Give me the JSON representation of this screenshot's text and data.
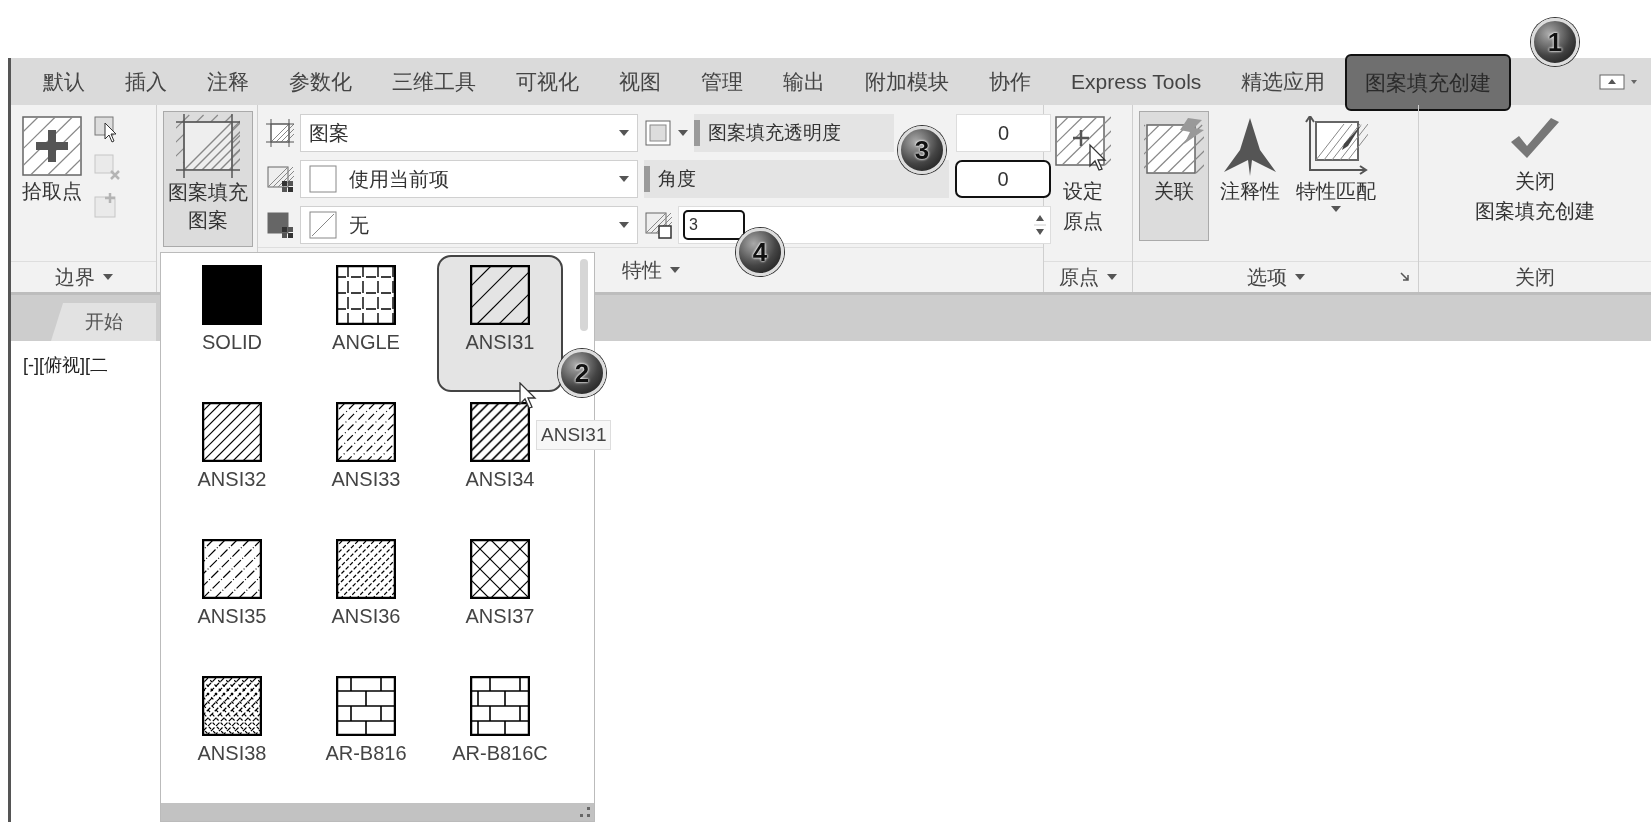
{
  "ribbon_tabs": [
    {
      "label": "默认",
      "selected": false
    },
    {
      "label": "插入",
      "selected": false
    },
    {
      "label": "注释",
      "selected": false
    },
    {
      "label": "参数化",
      "selected": false
    },
    {
      "label": "三维工具",
      "selected": false
    },
    {
      "label": "可视化",
      "selected": false
    },
    {
      "label": "视图",
      "selected": false
    },
    {
      "label": "管理",
      "selected": false
    },
    {
      "label": "输出",
      "selected": false
    },
    {
      "label": "附加模块",
      "selected": false
    },
    {
      "label": "协作",
      "selected": false
    },
    {
      "label": "Express Tools",
      "selected": false
    },
    {
      "label": "精选应用",
      "selected": false
    },
    {
      "label": "图案填充创建",
      "selected": true
    }
  ],
  "boundary_panel": {
    "pick_button": "拾取点",
    "tools": [
      {
        "disabled": false
      },
      {
        "disabled": true
      },
      {
        "disabled": true
      }
    ],
    "title": "边界"
  },
  "pattern_panel": {
    "button_lines": [
      "图案填充",
      "图案"
    ],
    "selected": true
  },
  "properties_panel": {
    "type_value": "图案",
    "color_value": "使用当前项",
    "background_value": "无",
    "transparency": {
      "label": "图案填充透明度",
      "level": 0,
      "value": "0"
    },
    "angle": {
      "label": "角度",
      "level": 0,
      "value": "0"
    },
    "scale_value": "3",
    "title": "特性"
  },
  "origin_panel": {
    "button_lines": [
      "设定",
      "原点"
    ],
    "title": "原点"
  },
  "options_panel": {
    "buttons": [
      {
        "kind": "associative",
        "label": "关联",
        "selected": true,
        "dropdown": false
      },
      {
        "kind": "annotative",
        "label": "注释性",
        "selected": false,
        "dropdown": false
      },
      {
        "kind": "match",
        "label": "特性匹配",
        "selected": false,
        "dropdown": true
      }
    ],
    "title": "选项"
  },
  "close_panel": {
    "button_lines": [
      "关闭",
      "图案填充创建"
    ],
    "title": "关闭"
  },
  "doc_tabs": [
    {
      "label": "开始",
      "selected": true
    }
  ],
  "viewport_label": "[-][俯视][二",
  "pattern_gallery": {
    "items": [
      {
        "kind": "solid",
        "label": "SOLID",
        "selected": false
      },
      {
        "kind": "angle",
        "label": "ANGLE",
        "selected": false
      },
      {
        "kind": "sparse",
        "label": "ANSI31",
        "selected": true
      },
      {
        "kind": "dense",
        "label": "ANSI32",
        "selected": false
      },
      {
        "kind": "dashed",
        "label": "ANSI33",
        "selected": false
      },
      {
        "kind": "double",
        "label": "ANSI34",
        "selected": false
      },
      {
        "kind": "dotted",
        "label": "ANSI35",
        "selected": false
      },
      {
        "kind": "wavy",
        "label": "ANSI36",
        "selected": false
      },
      {
        "kind": "cross",
        "label": "ANSI37",
        "selected": false
      },
      {
        "kind": "mesh",
        "label": "ANSI38",
        "selected": false
      },
      {
        "kind": "brick",
        "label": "AR-B816",
        "selected": false
      },
      {
        "kind": "brick2",
        "label": "AR-B816C",
        "selected": false
      }
    ],
    "tooltip": "ANSI31"
  },
  "callouts": [
    "1",
    "2",
    "3",
    "4"
  ]
}
